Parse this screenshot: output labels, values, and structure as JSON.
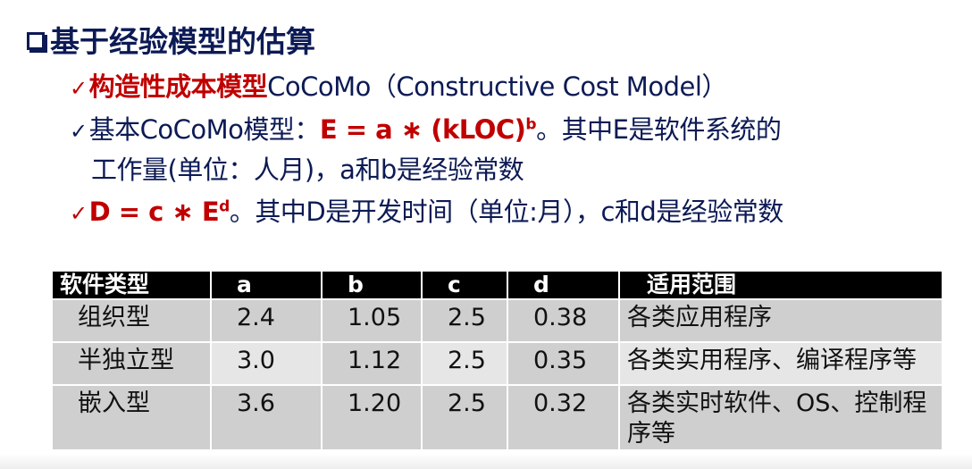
{
  "title": "基于经验模型的估算",
  "bullets": [
    {
      "red": "构造性成本模型",
      "text": "CoCoMo（Constructive Cost Model）"
    },
    {
      "pre": "基本CoCoMo模型：",
      "formula": "E = a ∗ (kLOC)",
      "sup": "b",
      "post": "。其中E是软件系统的",
      "cont": "工作量(单位：人月)，a和b是经验常数"
    },
    {
      "formula": "D = c ∗ E",
      "sup": "d",
      "post": "。其中D是开发时间（单位:月），c和d是经验常数"
    }
  ],
  "table": {
    "headers": [
      "软件类型",
      "a",
      "b",
      "c",
      "d",
      "适用范围"
    ],
    "rows": [
      [
        "组织型",
        "2.4",
        "1.05",
        "2.5",
        "0.38",
        "各类应用程序"
      ],
      [
        "半独立型",
        "3.0",
        "1.12",
        "2.5",
        "0.35",
        "各类实用程序、编译程序等"
      ],
      [
        "嵌入型",
        "3.6",
        "1.20",
        "2.5",
        "0.32",
        "各类实时软件、OS、控制程序等"
      ]
    ]
  },
  "colors": {
    "navy": "#0c1a55",
    "red": "#c00000"
  }
}
